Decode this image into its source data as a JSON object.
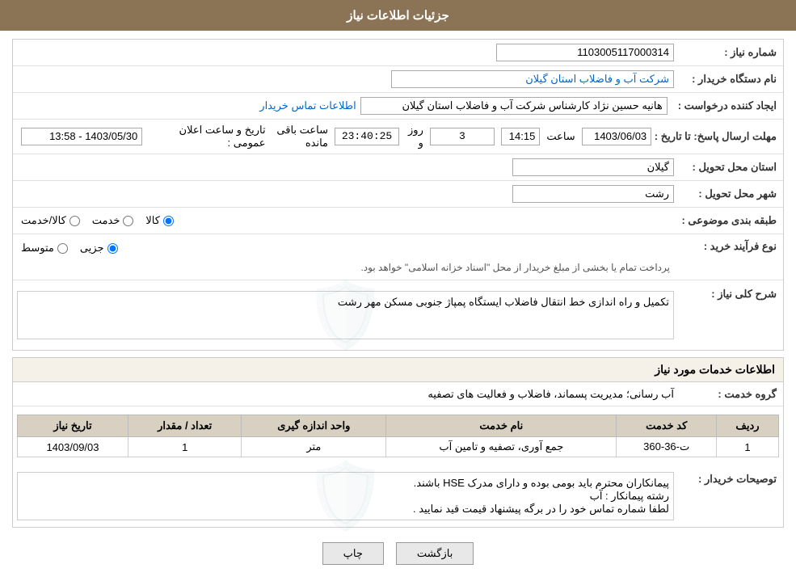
{
  "page": {
    "title": "جزئیات اطلاعات نیاز"
  },
  "header": {
    "back_button": "بازگشت",
    "print_button": "چاپ"
  },
  "fields": {
    "shomara_niaz_label": "شماره نیاز :",
    "shomara_niaz_value": "1103005117000314",
    "nam_dastgah_label": "نام دستگاه خریدار :",
    "nam_dastgah_value": "شرکت آب و فاضلاب استان گیلان",
    "ijad_konande_label": "ایجاد کننده درخواست :",
    "ijad_konande_value": "هانیه حسین نژاد کارشناس شرکت آب و فاضلاب استان گیلان",
    "etelaat_tamas_label": "اطلاعات تماس خریدار",
    "mohlat_ersal_label": "مهلت ارسال پاسخ: تا تاریخ :",
    "mohlat_date": "1403/06/03",
    "mohlat_saat_label": "ساعت",
    "mohlat_saat_value": "14:15",
    "countdown_label": "روز و",
    "countdown_days": "3",
    "countdown_time": "23:40:25",
    "countdown_remain": "ساعت باقی مانده",
    "ostan_tahvil_label": "استان محل تحویل :",
    "ostan_tahvil_value": "گیلان",
    "shahr_tahvil_label": "شهر محل تحویل :",
    "shahr_tahvil_value": "رشت",
    "tabaqe_label": "طبقه بندی موضوعی :",
    "tabaqe_kala": "کالا",
    "tabaqe_khadamat": "خدمت",
    "tabaqe_kala_khadamat": "کالا/خدمت",
    "now_farayand_label": "نوع فرآیند خرید :",
    "now_jozvi": "جزیی",
    "now_mottaset": "متوسط",
    "now_notice": "پرداخت تمام یا بخشی از مبلغ خریدار از محل \"اسناد خزانه اسلامی\" خواهد بود.",
    "sharh_niaz_label": "شرح کلی نیاز :",
    "sharh_niaz_value": "تکمیل و راه اندازی خط انتقال فاضلاب ایستگاه پمپاژ جنوبی مسکن مهر رشت",
    "service_info_title": "اطلاعات خدمات مورد نیاز",
    "gorooh_khadamat_label": "گروه خدمت :",
    "gorooh_khadamat_value": "آب رسانی؛ مدیریت پسماند، فاضلاب و فعالیت های تصفیه",
    "table": {
      "col_radif": "ردیف",
      "col_code": "کد خدمت",
      "col_name": "نام خدمت",
      "col_unit": "واحد اندازه گیری",
      "col_tedad": "تعداد / مقدار",
      "col_date": "تاریخ نیاز",
      "rows": [
        {
          "radif": "1",
          "code": "ت-36-360",
          "name": "جمع آوری، تصفیه و تامین آب",
          "unit": "متر",
          "tedad": "1",
          "date": "1403/09/03"
        }
      ]
    },
    "tosifat_label": "توصیحات خریدار :",
    "tosifat_line1": "پیمانکاران محترم باید  بومی بوده و  دارای مدرک HSE باشند.",
    "tosifat_line2": "رشته پیمانکار :  آب",
    "tosifat_line3": "لطفا شماره تماس خود را در برگه پیشنهاد قیمت قید نمایید ."
  }
}
